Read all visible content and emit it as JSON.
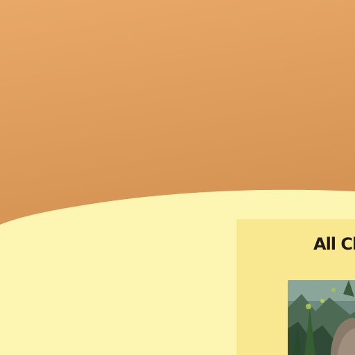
{
  "theme": {
    "header_color_light": "#e8a868",
    "header_color_dark": "#d69454",
    "page_background": "#fdf6b2",
    "card_background": "#f9e890",
    "title_color": "#1f1a14"
  },
  "card": {
    "title": "All Cl",
    "image_icon": "forest-scene-image"
  }
}
